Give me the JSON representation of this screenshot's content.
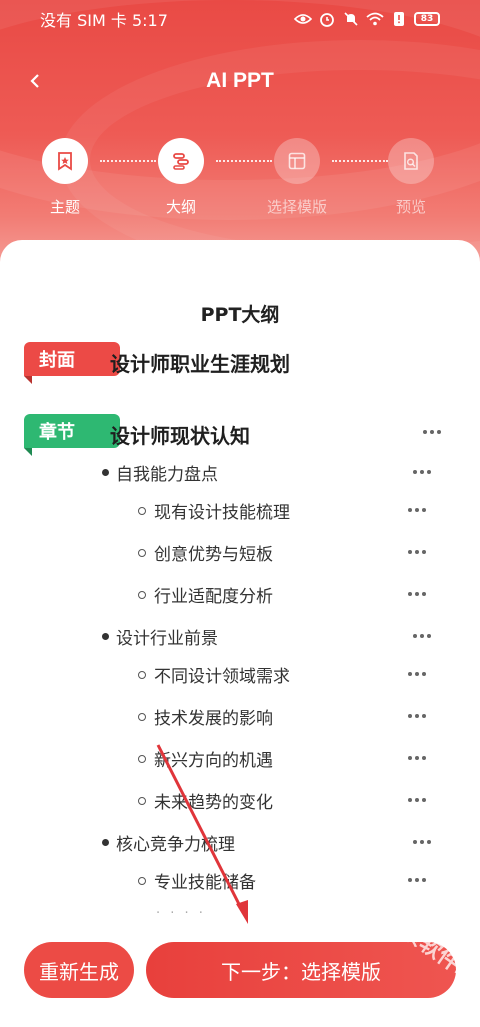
{
  "status_bar": {
    "carrier_time": "没有 SIM 卡 5:17",
    "battery": "83"
  },
  "nav": {
    "title": "AI PPT"
  },
  "steps": [
    {
      "label": "主题",
      "state": "done",
      "icon": "bookmark-icon"
    },
    {
      "label": "大纲",
      "state": "active",
      "icon": "outline-icon"
    },
    {
      "label": "选择模版",
      "state": "todo",
      "icon": "template-icon"
    },
    {
      "label": "预览",
      "state": "todo",
      "icon": "preview-icon"
    }
  ],
  "outline": {
    "title": "PPT大纲",
    "cover": {
      "tag": "封面",
      "text": "设计师职业生涯规划"
    },
    "chapter": {
      "tag": "章节",
      "text": "设计师现状认知"
    },
    "sections": [
      {
        "text": "自我能力盘点",
        "items": [
          "现有设计技能梳理",
          "创意优势与短板",
          "行业适配度分析"
        ]
      },
      {
        "text": "设计行业前景",
        "items": [
          "不同设计领域需求",
          "技术发展的影响",
          "新兴方向的机遇",
          "未来趋势的变化"
        ]
      },
      {
        "text": "核心竞争力梳理",
        "items": [
          "专业技能储备"
        ]
      }
    ],
    "more_indicator": "· · · ·"
  },
  "buttons": {
    "regenerate": "重新生成",
    "next": "下一步：选择模版"
  },
  "watermark": "千景软件站",
  "colors": {
    "brand_red": "#ec4a46",
    "chapter_green": "#2eb872"
  }
}
